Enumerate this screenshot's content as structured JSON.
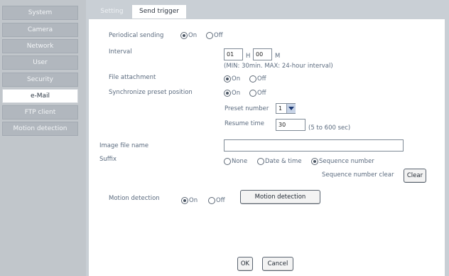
{
  "sidebar": {
    "items": [
      {
        "label": "System"
      },
      {
        "label": "Camera"
      },
      {
        "label": "Network"
      },
      {
        "label": "User"
      },
      {
        "label": "Security"
      },
      {
        "label": "e-Mail"
      },
      {
        "label": "FTP client"
      },
      {
        "label": "Motion detection"
      }
    ],
    "active": "e-Mail"
  },
  "tabs": [
    {
      "label": "Setting"
    },
    {
      "label": "Send trigger"
    }
  ],
  "form": {
    "periodical": {
      "label": "Periodical sending",
      "on": "On",
      "off": "Off",
      "selected": "On"
    },
    "interval": {
      "label": "Interval",
      "hours": "01",
      "h_unit": "H",
      "minutes": "00",
      "m_unit": "M",
      "hint": "(MIN: 30min. MAX: 24-hour interval)"
    },
    "file_attachment": {
      "label": "File attachment",
      "on": "On",
      "off": "Off",
      "selected": "On"
    },
    "sync_preset": {
      "label": "Synchronize preset position",
      "on": "On",
      "off": "Off",
      "selected": "On"
    },
    "preset_number": {
      "label": "Preset number",
      "value": "1"
    },
    "resume_time": {
      "label": "Resume time",
      "value": "30",
      "hint": "(5 to 600 sec)"
    },
    "image_file_name": {
      "label": "Image file name",
      "value": ""
    },
    "suffix": {
      "label": "Suffix",
      "none": "None",
      "date_time": "Date & time",
      "sequence": "Sequence number",
      "selected": "Sequence number"
    },
    "sequence_clear": {
      "label": "Sequence number clear",
      "button": "Clear"
    },
    "motion": {
      "label": "Motion detection",
      "on": "On",
      "off": "Off",
      "selected": "On",
      "button": "Motion detection"
    }
  },
  "footer": {
    "ok": "OK",
    "cancel": "Cancel"
  }
}
